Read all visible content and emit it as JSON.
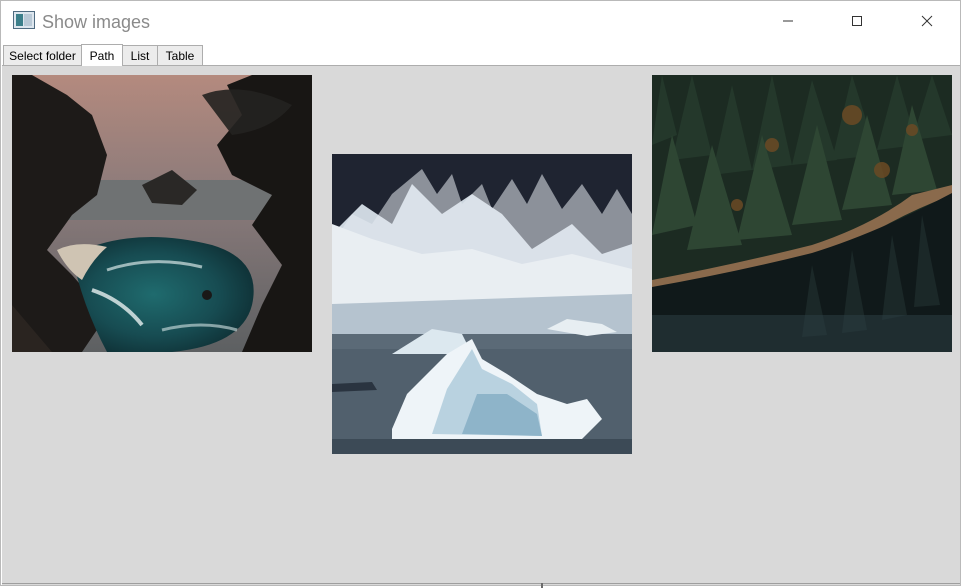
{
  "window": {
    "title": "Show images",
    "icon": "app-window-icon",
    "controls": [
      "minimize-icon",
      "maximize-icon",
      "close-icon"
    ]
  },
  "tabs": [
    {
      "label": "Select folder",
      "active": false
    },
    {
      "label": "Path",
      "active": true
    },
    {
      "label": "List",
      "active": false
    },
    {
      "label": "Table",
      "active": false
    }
  ],
  "images": [
    {
      "subject": "coastal-cove-waterfall"
    },
    {
      "subject": "icebergs-glacier"
    },
    {
      "subject": "forest-lake-shore"
    }
  ],
  "colors": {
    "content_bg": "#d9d9d9",
    "title_text": "#8a8a8a",
    "tab_active": "#ffffff",
    "tab_inactive": "#ececec"
  }
}
